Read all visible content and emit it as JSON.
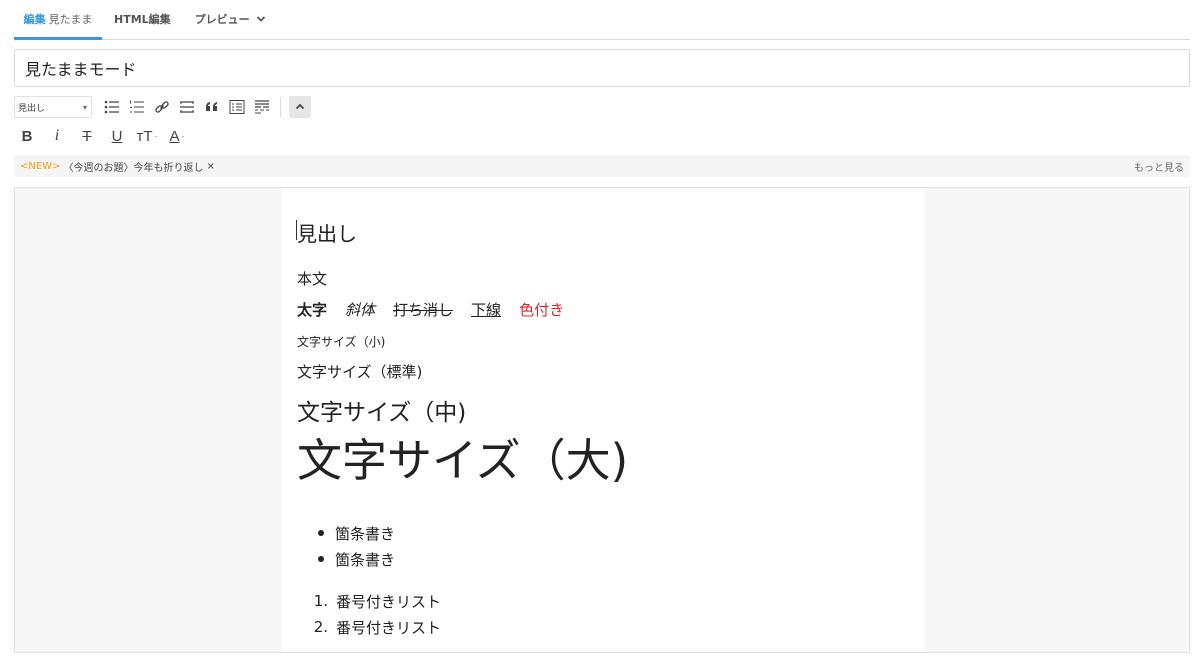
{
  "tabs": {
    "edit_bold": "編集",
    "edit_sub": "見たまま",
    "html": "HTML編集",
    "preview": "プレビュー"
  },
  "title_value": "見たままモード",
  "toolbar": {
    "heading_select": "見出し",
    "format_b": "B",
    "format_i": "i",
    "format_s": "T",
    "format_u": "U",
    "format_size": "тT",
    "format_color": "A",
    "dot": "·"
  },
  "notice": {
    "tag": "<NEW>",
    "text": "〈今週のお題〉今年も折り返し",
    "close": "×",
    "more": "もっと見る"
  },
  "content": {
    "heading": "見出し",
    "body": "本文",
    "bold": "太字",
    "italic": "斜体",
    "strike": "打ち消し",
    "underline": "下線",
    "colored": "色付き",
    "size_small": "文字サイズ（小)",
    "size_normal": "文字サイズ（標準)",
    "size_medium": "文字サイズ（中)",
    "size_large": "文字サイズ（大)",
    "bullets": [
      "箇条書き",
      "箇条書き"
    ],
    "numbered": [
      "番号付きリスト",
      "番号付きリスト"
    ],
    "numbers": [
      "1.",
      "2."
    ]
  },
  "colors": {
    "accent": "#3598dc",
    "new_tag": "#f39c12",
    "red_text": "#e8232a"
  }
}
